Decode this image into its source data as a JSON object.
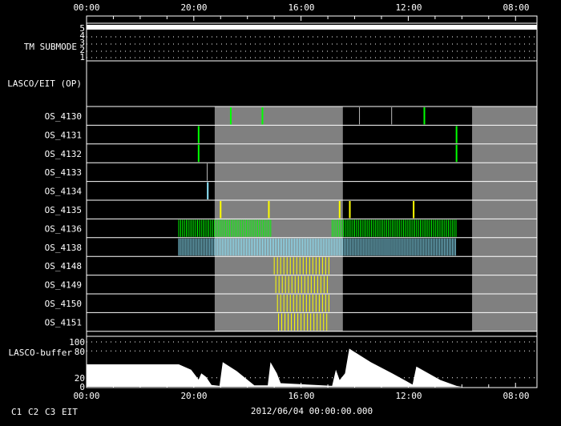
{
  "chart_data": {
    "type": "timeline",
    "x_unit": "hours since start",
    "x_range": [
      0,
      84
    ],
    "x_ticks": [
      {
        "h": 0,
        "label": "00:00"
      },
      {
        "h": 20,
        "label": "20:00"
      },
      {
        "h": 40,
        "label": "16:00"
      },
      {
        "h": 60,
        "label": "12:00"
      },
      {
        "h": 80,
        "label": "08:00"
      }
    ],
    "date_label": "2012/06/04 00:00:00.000",
    "colors": {
      "C1": "#ff2020",
      "C2": "#00ff00",
      "C3": "#90e8ff",
      "EIT": "#ffff00",
      "gray_line": "#bbbbbb",
      "shade": "#808080"
    },
    "legend": [
      {
        "label": "C1",
        "color": "#ff2020"
      },
      {
        "label": "C2",
        "color": "#00ff00"
      },
      {
        "label": "C3",
        "color": "#90e8ff"
      },
      {
        "label": "EIT",
        "color": "#ffff00"
      }
    ],
    "tm_submode": {
      "label": "TM SUBMODE",
      "levels": [
        "5",
        "4",
        "3",
        "2",
        "1"
      ],
      "value": 5
    },
    "lasco_eit_op": {
      "label": "LASCO/EIT (OP)"
    },
    "shaded_intervals": [
      [
        23.9,
        47.8
      ],
      [
        71.9,
        84
      ]
    ],
    "rows": [
      {
        "name": "OS_4130",
        "events": [
          {
            "h": 26.9,
            "c": "C2"
          },
          {
            "h": 32.8,
            "c": "C2"
          },
          {
            "h": 50.9,
            "c": "gray_line"
          },
          {
            "h": 56.9,
            "c": "gray_line"
          },
          {
            "h": 63.0,
            "c": "C2"
          }
        ],
        "dense": []
      },
      {
        "name": "OS_4131",
        "events": [
          {
            "h": 20.9,
            "c": "C2"
          },
          {
            "h": 69.0,
            "c": "C2"
          }
        ],
        "dense": []
      },
      {
        "name": "OS_4132",
        "events": [
          {
            "h": 20.9,
            "c": "C2"
          },
          {
            "h": 69.0,
            "c": "C2"
          }
        ],
        "dense": []
      },
      {
        "name": "OS_4133",
        "events": [
          {
            "h": 22.5,
            "c": "gray_line"
          }
        ],
        "dense": []
      },
      {
        "name": "OS_4134",
        "events": [
          {
            "h": 22.6,
            "c": "C3"
          }
        ],
        "dense": []
      },
      {
        "name": "OS_4135",
        "events": [
          {
            "h": 25.0,
            "c": "EIT"
          },
          {
            "h": 34.0,
            "c": "EIT"
          },
          {
            "h": 47.2,
            "c": "EIT"
          },
          {
            "h": 49.1,
            "c": "EIT"
          },
          {
            "h": 61.0,
            "c": "EIT"
          }
        ],
        "dense": []
      },
      {
        "name": "OS_4136",
        "events": [],
        "dense": [
          {
            "from": 17.2,
            "to": 34.6,
            "step": 0.35,
            "c": "C2"
          },
          {
            "from": 45.8,
            "to": 69.0,
            "step": 0.35,
            "c": "C2"
          }
        ]
      },
      {
        "name": "OS_4138",
        "events": [],
        "dense": [
          {
            "from": 17.2,
            "to": 69.0,
            "step": 0.3,
            "c": "C3"
          }
        ]
      },
      {
        "name": "OS_4148",
        "events": [],
        "dense": [
          {
            "from": 35.0,
            "to": 45.4,
            "step": 0.6,
            "c": "EIT"
          }
        ]
      },
      {
        "name": "OS_4149",
        "events": [],
        "dense": [
          {
            "from": 35.3,
            "to": 45.4,
            "step": 0.6,
            "c": "EIT"
          }
        ]
      },
      {
        "name": "OS_4150",
        "events": [],
        "dense": [
          {
            "from": 35.6,
            "to": 45.4,
            "step": 0.6,
            "c": "EIT"
          }
        ]
      },
      {
        "name": "OS_4151",
        "events": [],
        "dense": [
          {
            "from": 35.8,
            "to": 45.4,
            "step": 0.6,
            "c": "EIT"
          }
        ]
      }
    ],
    "buffer": {
      "label": "LASCO-buffer",
      "y_ticks": [
        "100",
        "80",
        "20",
        "0"
      ],
      "y_tick_values": [
        100,
        80,
        20,
        0
      ],
      "ylim": [
        0,
        100
      ],
      "points": [
        [
          0,
          50
        ],
        [
          17.2,
          50
        ],
        [
          19.5,
          38
        ],
        [
          20.9,
          16
        ],
        [
          21.4,
          30
        ],
        [
          22.3,
          22
        ],
        [
          23.3,
          4
        ],
        [
          24.8,
          2
        ],
        [
          25.4,
          55
        ],
        [
          28,
          35
        ],
        [
          31.3,
          3
        ],
        [
          33.8,
          3
        ],
        [
          34.3,
          55
        ],
        [
          35.5,
          30
        ],
        [
          36.2,
          8
        ],
        [
          45.8,
          2
        ],
        [
          46.5,
          38
        ],
        [
          47.2,
          15
        ],
        [
          48.2,
          30
        ],
        [
          49,
          85
        ],
        [
          53,
          55
        ],
        [
          57,
          30
        ],
        [
          60.8,
          5
        ],
        [
          61.5,
          45
        ],
        [
          63,
          35
        ],
        [
          66,
          15
        ],
        [
          69,
          2
        ],
        [
          70,
          0
        ],
        [
          84,
          0
        ]
      ]
    }
  }
}
